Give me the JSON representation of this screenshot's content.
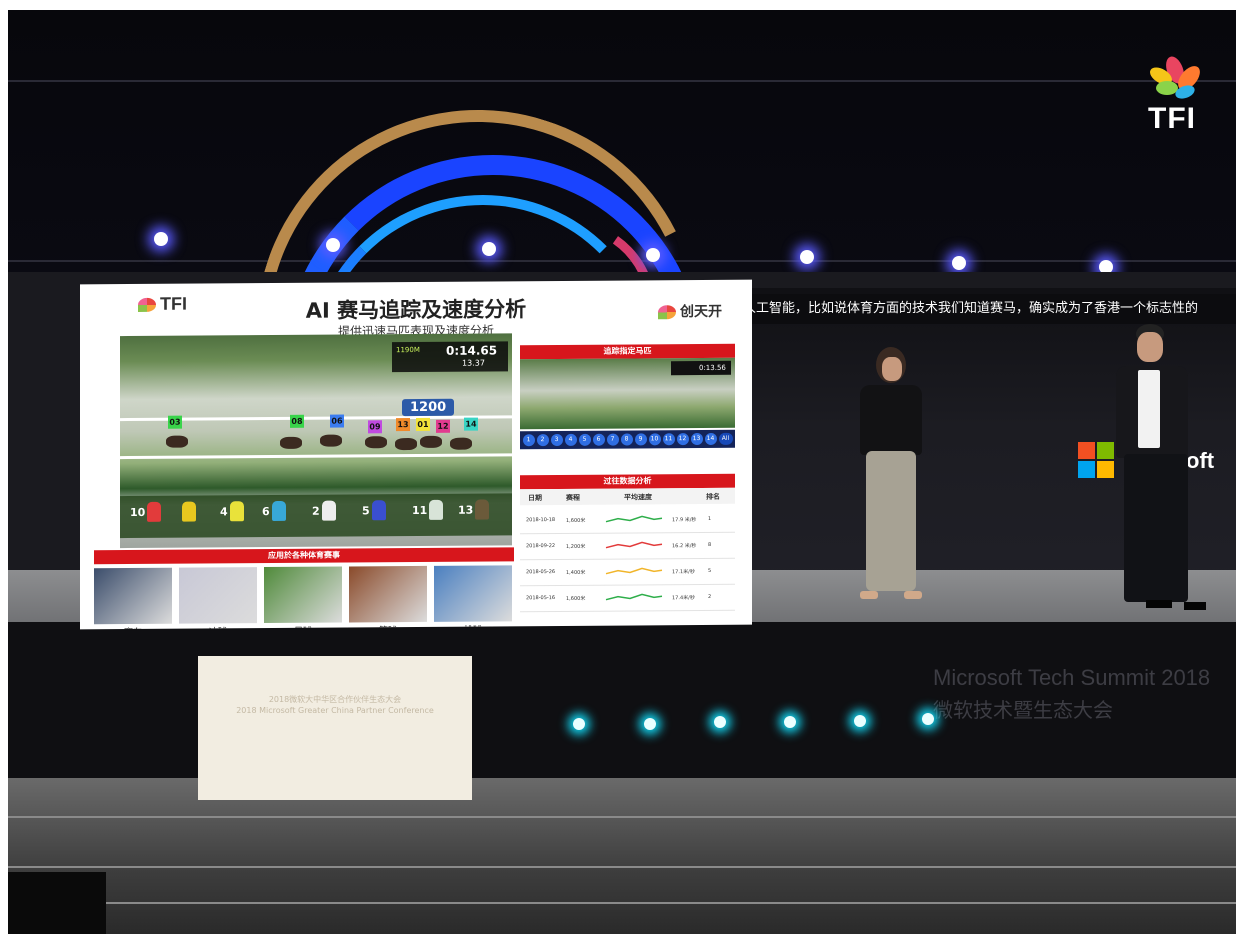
{
  "watermark": {
    "brand": "TFI"
  },
  "slide": {
    "logo_left": "TFI",
    "logo_right": "创天开",
    "title": "AI 赛马追踪及速度分析",
    "subtitle": "提供迅速马匹表现及速度分析",
    "race": {
      "distance_tag": "1190M",
      "time_main": "0:14.65",
      "time_split": "13.37",
      "marker": "1200",
      "jockeys": [
        "10",
        "4",
        "6",
        "2",
        "5",
        "11",
        "13"
      ],
      "tracked_numbers": [
        "03",
        "08",
        "06",
        "09",
        "13",
        "01",
        "12",
        "14"
      ]
    },
    "track_panel": {
      "heading": "追踪指定马匹",
      "mini_timer": "0:13.56",
      "lanes": [
        "1",
        "2",
        "3",
        "4",
        "5",
        "6",
        "7",
        "8",
        "9",
        "10",
        "11",
        "12",
        "13",
        "14",
        "All"
      ]
    },
    "history_panel": {
      "heading": "过往数据分析",
      "columns": [
        "日期",
        "赛程",
        "平均速度",
        "排名"
      ],
      "rows": [
        {
          "date": "2018-10-18",
          "distance": "1,600米",
          "speed": "17.9 米/秒",
          "rank": "1",
          "line_color": "#2eae4a"
        },
        {
          "date": "2018-09-22",
          "distance": "1,200米",
          "speed": "16.2 米/秒",
          "rank": "8",
          "line_color": "#e23b3b"
        },
        {
          "date": "2018-05-26",
          "distance": "1,400米",
          "speed": "17.1米/秒",
          "rank": "5",
          "line_color": "#f1b52a"
        },
        {
          "date": "2018-05-16",
          "distance": "1,600米",
          "speed": "17.4米/秒",
          "rank": "2",
          "line_color": "#2eae4a"
        }
      ]
    },
    "sports": {
      "heading": "应用於各种体育赛事",
      "items": [
        {
          "label": "赛车",
          "color": "#3b4d6b"
        },
        {
          "label": "冰球",
          "color": "#c8c8d6"
        },
        {
          "label": "足球",
          "color": "#4f8a3a"
        },
        {
          "label": "篮球",
          "color": "#8a4a2a"
        },
        {
          "label": "排球",
          "color": "#4a7fc0"
        }
      ]
    }
  },
  "caption": "人工智能，比如说体育方面的技术我们知道赛马，确实成为了香港一个标志性的",
  "side_screen_text": "oft",
  "lectern": {
    "line1": "2018微软大中华区合作伙伴生态大会",
    "line2": "2018 Microsoft Greater China Partner Conference"
  },
  "backdrop": {
    "line1": "Microsoft Tech Summit 2018",
    "line2": "微软技术暨生态大会"
  }
}
